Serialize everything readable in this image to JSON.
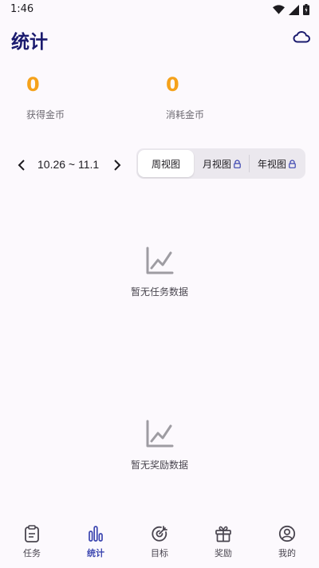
{
  "status": {
    "time": "1:46"
  },
  "header": {
    "title": "统计"
  },
  "stats": [
    {
      "value": "0",
      "label": "获得金币"
    },
    {
      "value": "0",
      "label": "消耗金币"
    }
  ],
  "date_range": "10.26 ~ 11.1",
  "view_tabs": [
    {
      "label": "周视图",
      "locked": false
    },
    {
      "label": "月视图",
      "locked": true
    },
    {
      "label": "年视图",
      "locked": true
    }
  ],
  "empty_states": [
    {
      "text": "暂无任务数据",
      "icon": "chart-line-icon"
    },
    {
      "text": "暂无奖励数据",
      "icon": "chart-line-icon"
    }
  ],
  "bottom_nav": [
    {
      "label": "任务",
      "icon": "clipboard-icon",
      "active": false
    },
    {
      "label": "统计",
      "icon": "bar-chart-icon",
      "active": true
    },
    {
      "label": "目标",
      "icon": "target-icon",
      "active": false
    },
    {
      "label": "奖励",
      "icon": "gift-icon",
      "active": false
    },
    {
      "label": "我的",
      "icon": "user-icon",
      "active": false
    }
  ],
  "colors": {
    "accent": "#3c46b0",
    "title": "#1a1a6e",
    "coin": "#f5a21b",
    "background": "#fcf9fd"
  }
}
